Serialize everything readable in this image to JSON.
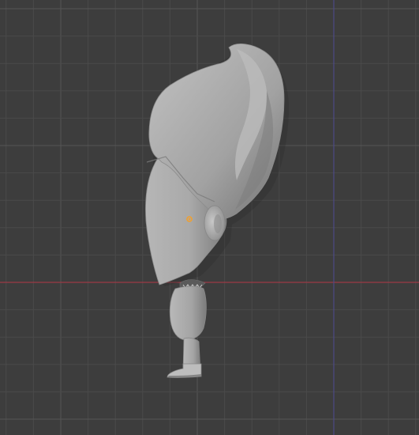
{
  "app": {
    "view": "3d-viewport",
    "projection": "orthographic-side",
    "grid_visible": true
  },
  "colors": {
    "background": "#3d3d3d",
    "grid_minor": "#4a4a4a",
    "grid_major": "#555555",
    "x_axis": "#9c3a46",
    "z_axis": "#4c4a86",
    "mesh_base": "#a8a8a8",
    "mesh_highlight": "#c4c4c4",
    "mesh_shadow": "#6f6f6f",
    "origin_point": "#f0a030"
  },
  "scene": {
    "object": "character-sculpt",
    "origin_marker": "object-origin",
    "shading": "solid"
  }
}
